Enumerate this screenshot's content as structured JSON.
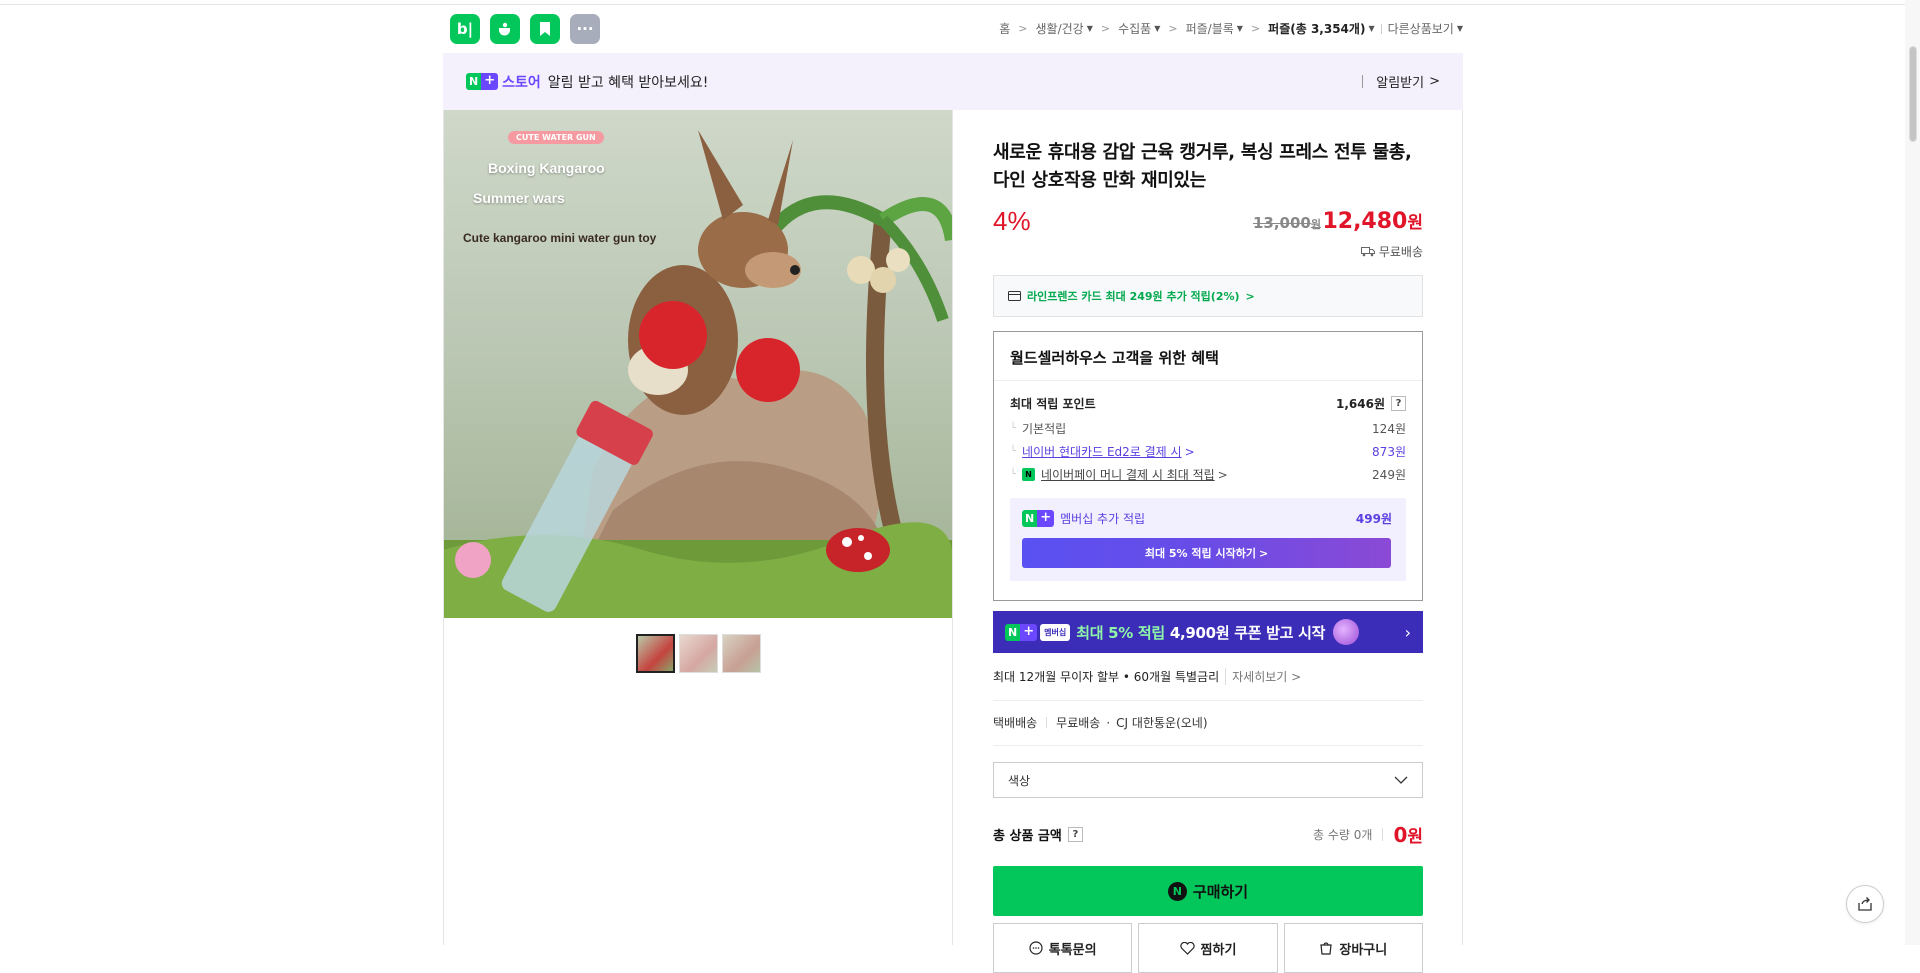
{
  "header": {
    "apps": [
      {
        "name": "blog-app",
        "label": "b|"
      },
      {
        "name": "cafe-app",
        "label": ""
      },
      {
        "name": "bookmark-app",
        "label": ""
      },
      {
        "name": "more-apps",
        "label": "···"
      }
    ],
    "breadcrumb": {
      "home": "홈",
      "cat1": "생활/건강",
      "cat2": "수집품",
      "cat3": "퍼즐/블록",
      "current": "퍼즐(총 3,354개)",
      "more": "다른상품보기"
    }
  },
  "alert_bar": {
    "store_label": "스토어",
    "message": "알림 받고 혜택 받아보세요!",
    "action": "알림받기"
  },
  "image_text": {
    "badge": "CUTE WATER GUN",
    "line1": "Boxing Kangaroo",
    "line2": "Summer wars",
    "line3": "Cute kangaroo mini water gun toy"
  },
  "product": {
    "title": "새로운 휴대용 감압 근육 캥거루, 복싱 프레스 전투 물총, 다인 상호작용 만화 재미있는",
    "discount": "4%",
    "original_price": "13,000",
    "original_unit": "원",
    "sale_price": "12,480",
    "sale_unit": "원",
    "shipping": "무료배송"
  },
  "card_benefit": "라인프렌즈 카드 최대 249원 추가 적립(2%)",
  "benefits": {
    "title": "월드셀러하우스 고객을 위한 혜택",
    "max_points_label": "최대 적립 포인트",
    "max_points_value": "1,646원",
    "rows": [
      {
        "label": "기본적립",
        "value": "124원"
      },
      {
        "label": "네이버 현대카드 Ed2로 결제 시",
        "value": "873원"
      },
      {
        "label": "네이버페이 머니 결제 시 최대 적립",
        "value": "249원"
      }
    ],
    "membership_label": "멤버십 추가 적립",
    "membership_value": "499원",
    "membership_button": "최대 5% 적립 시작하기"
  },
  "banner": {
    "badge": "멤버십",
    "text_highlight": "최대 5% 적립",
    "text_rest": "4,900원 쿠폰 받고 시작"
  },
  "installment": {
    "text": "최대 12개월 무이자 할부 • 60개월 특별금리",
    "more": "자세히보기"
  },
  "delivery": {
    "method": "택배배송",
    "fee": "무료배송",
    "courier": "CJ 대한통운(오네)"
  },
  "option_select": {
    "placeholder": "색상"
  },
  "total": {
    "label": "총 상품 금액",
    "qty": "총 수량 0개",
    "price": "0",
    "unit": "원"
  },
  "buttons": {
    "buy": "구매하기",
    "talk": "톡톡문의",
    "wish": "찜하기",
    "cart": "장바구니"
  },
  "colors": {
    "naver_green": "#03c75a",
    "price_red": "#e0152a",
    "membership_purple": "#6b48ff"
  }
}
